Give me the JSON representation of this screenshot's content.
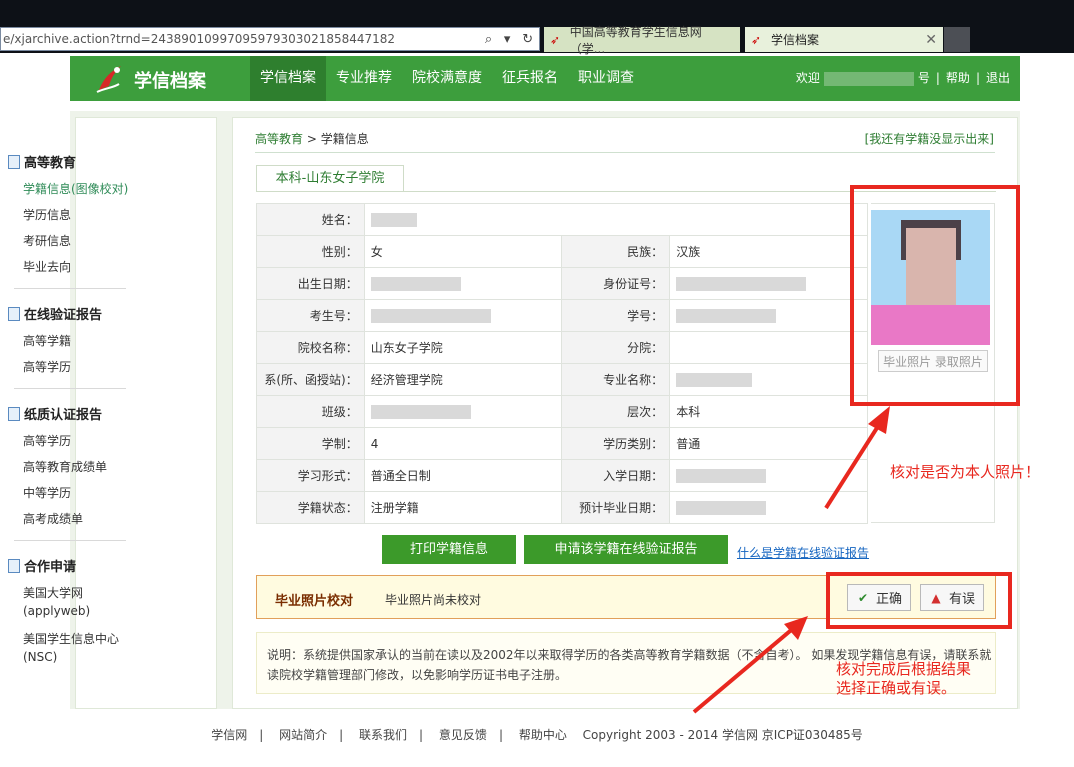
{
  "browser": {
    "url": "e/xjarchive.action?trnd=24389010997095979303021858447182",
    "tab1_title": "中国高等教育学生信息网（学...",
    "tab2_title": "学信档案"
  },
  "header": {
    "brand": "学信档案",
    "nav": [
      "学信档案",
      "专业推荐",
      "院校满意度",
      "征兵报名",
      "职业调查"
    ],
    "welcome": "欢迎",
    "welcome_suffix": "号",
    "help": "帮助",
    "logout": "退出",
    "sep": "|"
  },
  "sidebar": {
    "sections": [
      {
        "title": "高等教育",
        "items": [
          "学籍信息(图像校对)",
          "学历信息",
          "考研信息",
          "毕业去向"
        ]
      },
      {
        "title": "在线验证报告",
        "items": [
          "高等学籍",
          "高等学历"
        ]
      },
      {
        "title": "纸质认证报告",
        "items": [
          "高等学历",
          "高等教育成绩单",
          "中等学历",
          "高考成绩单"
        ]
      },
      {
        "title": "合作申请",
        "items": [
          "美国大学网",
          "(applyweb)",
          "美国学生信息中心",
          "(NSC)"
        ]
      }
    ]
  },
  "breadcrumb": {
    "part1": "高等教育",
    "sep": ">",
    "part2": "学籍信息"
  },
  "missing_link": "[我还有学籍没显示出来]",
  "school_tab": "本科-山东女子学院",
  "fields": {
    "name_label": "姓名：",
    "gender_label": "性别：",
    "gender": "女",
    "ethnicity_label": "民族：",
    "ethnicity": "汉族",
    "birth_label": "出生日期：",
    "id_label": "身份证号：",
    "exam_no_label": "考生号：",
    "student_no_label": "学号：",
    "school_label": "院校名称：",
    "school": "山东女子学院",
    "branch_label": "分院：",
    "dept_label": "系(所、函授站)：",
    "dept": "经济管理学院",
    "major_label": "专业名称：",
    "class_label": "班级：",
    "level_label": "层次：",
    "level": "本科",
    "duration_label": "学制：",
    "duration": "4",
    "category_label": "学历类别：",
    "category": "普通",
    "form_label": "学习形式：",
    "form": "普通全日制",
    "enroll_label": "入学日期：",
    "status_label": "学籍状态：",
    "status": "注册学籍",
    "grad_label": "预计毕业日期："
  },
  "photo": {
    "buttons": "毕业照片  录取照片"
  },
  "buttons": {
    "print": "打印学籍信息",
    "apply": "申请该学籍在线验证报告",
    "what_link": "什么是学籍在线验证报告"
  },
  "verify": {
    "title": "毕业照片校对",
    "status": "毕业照片尚未校对",
    "ok": "正确",
    "error": "有误"
  },
  "note": "说明：系统提供国家承认的当前在读以及2002年以来取得学历的各类高等教育学籍数据（不含自考）。 如果发现学籍信息有误，请联系就读院校学籍管理部门修改，以免影响学历证书电子注册。",
  "footer": {
    "links": [
      "学信网",
      "网站简介",
      "联系我们",
      "意见反馈",
      "帮助中心"
    ],
    "sep": "|",
    "copyright": "Copyright 2003 - 2014 学信网 京ICP证030485号"
  },
  "annotations": {
    "a1": "核对是否为本人照片！",
    "a2_line1": "核对完成后根据结果",
    "a2_line2": "选择正确或有误。",
    "color": "#e8281f"
  }
}
